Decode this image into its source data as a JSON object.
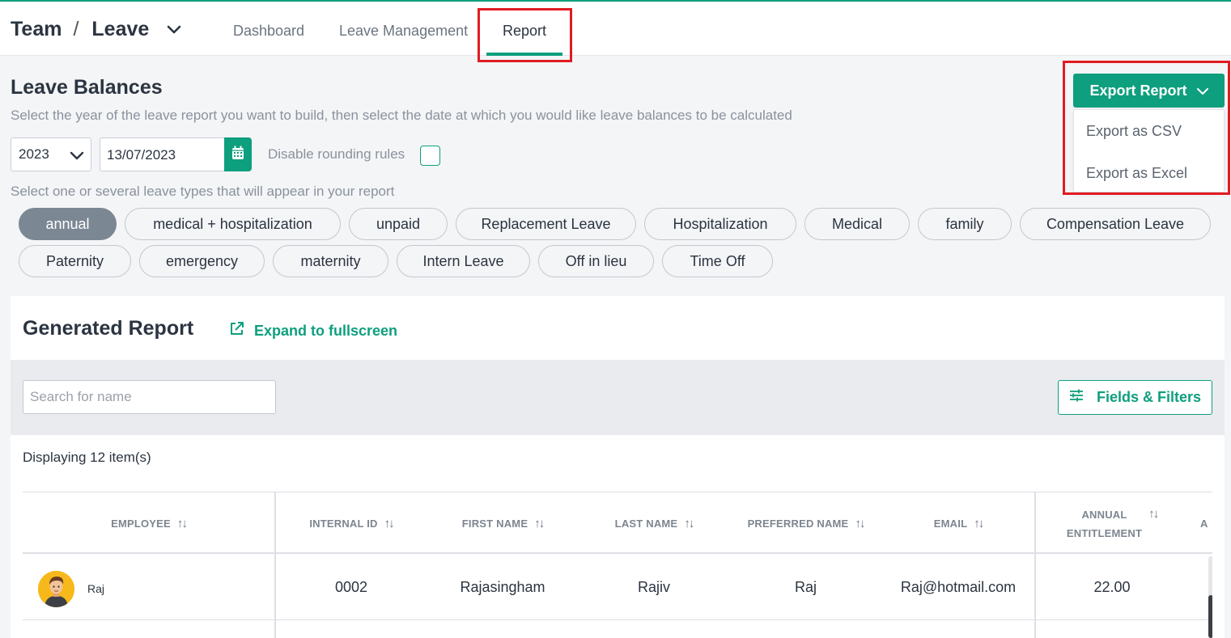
{
  "header": {
    "breadcrumb_team": "Team",
    "breadcrumb_sep": "/",
    "breadcrumb_leave": "Leave",
    "tabs": [
      {
        "label": "Dashboard"
      },
      {
        "label": "Leave Management"
      },
      {
        "label": "Report"
      }
    ],
    "active_tab": "Report"
  },
  "balances": {
    "title": "Leave Balances",
    "subtitle": "Select the year of the leave report you want to build, then select the date at which you would like leave balances to be calculated",
    "year": "2023",
    "date": "13/07/2023",
    "rounding_label": "Disable rounding rules",
    "rounding_checked": false,
    "types_label": "Select one or several leave types that will appear in your report",
    "leave_types": [
      {
        "label": "annual",
        "selected": true
      },
      {
        "label": "medical + hospitalization",
        "selected": false
      },
      {
        "label": "unpaid",
        "selected": false
      },
      {
        "label": "Replacement Leave",
        "selected": false
      },
      {
        "label": "Hospitalization",
        "selected": false
      },
      {
        "label": "Medical",
        "selected": false
      },
      {
        "label": "family",
        "selected": false
      },
      {
        "label": "Compensation Leave",
        "selected": false
      },
      {
        "label": "Paternity",
        "selected": false
      },
      {
        "label": "emergency",
        "selected": false
      },
      {
        "label": "maternity",
        "selected": false
      },
      {
        "label": "Intern Leave",
        "selected": false
      },
      {
        "label": "Off in lieu",
        "selected": false
      },
      {
        "label": "Time Off",
        "selected": false
      }
    ]
  },
  "export": {
    "button_label": "Export Report",
    "menu": [
      {
        "label": "Export as CSV"
      },
      {
        "label": "Export as Excel"
      }
    ]
  },
  "report": {
    "title": "Generated Report",
    "expand_label": "Expand to fullscreen",
    "search_placeholder": "Search for name",
    "fields_filters_label": "Fields & Filters",
    "displaying": "Displaying 12 item(s)",
    "columns": {
      "employee": "EMPLOYEE",
      "internal_id": "INTERNAL ID",
      "first_name": "FIRST NAME",
      "last_name": "LAST NAME",
      "preferred_name": "PREFERRED NAME",
      "email": "EMAIL",
      "annual_entitlement_1": "ANNUAL",
      "annual_entitlement_2": "ENTITLEMENT",
      "next_partial": "A"
    },
    "rows": [
      {
        "employee": "Raj",
        "internal_id": "0002",
        "first_name": "Rajasingham",
        "last_name": "Rajiv",
        "preferred_name": "Raj",
        "email": "Raj@hotmail.com",
        "annual_entitlement": "22.00"
      }
    ]
  },
  "colors": {
    "accent": "#0e9f7e",
    "highlight_box": "#e11b22",
    "chip_selected": "#7c8794"
  }
}
